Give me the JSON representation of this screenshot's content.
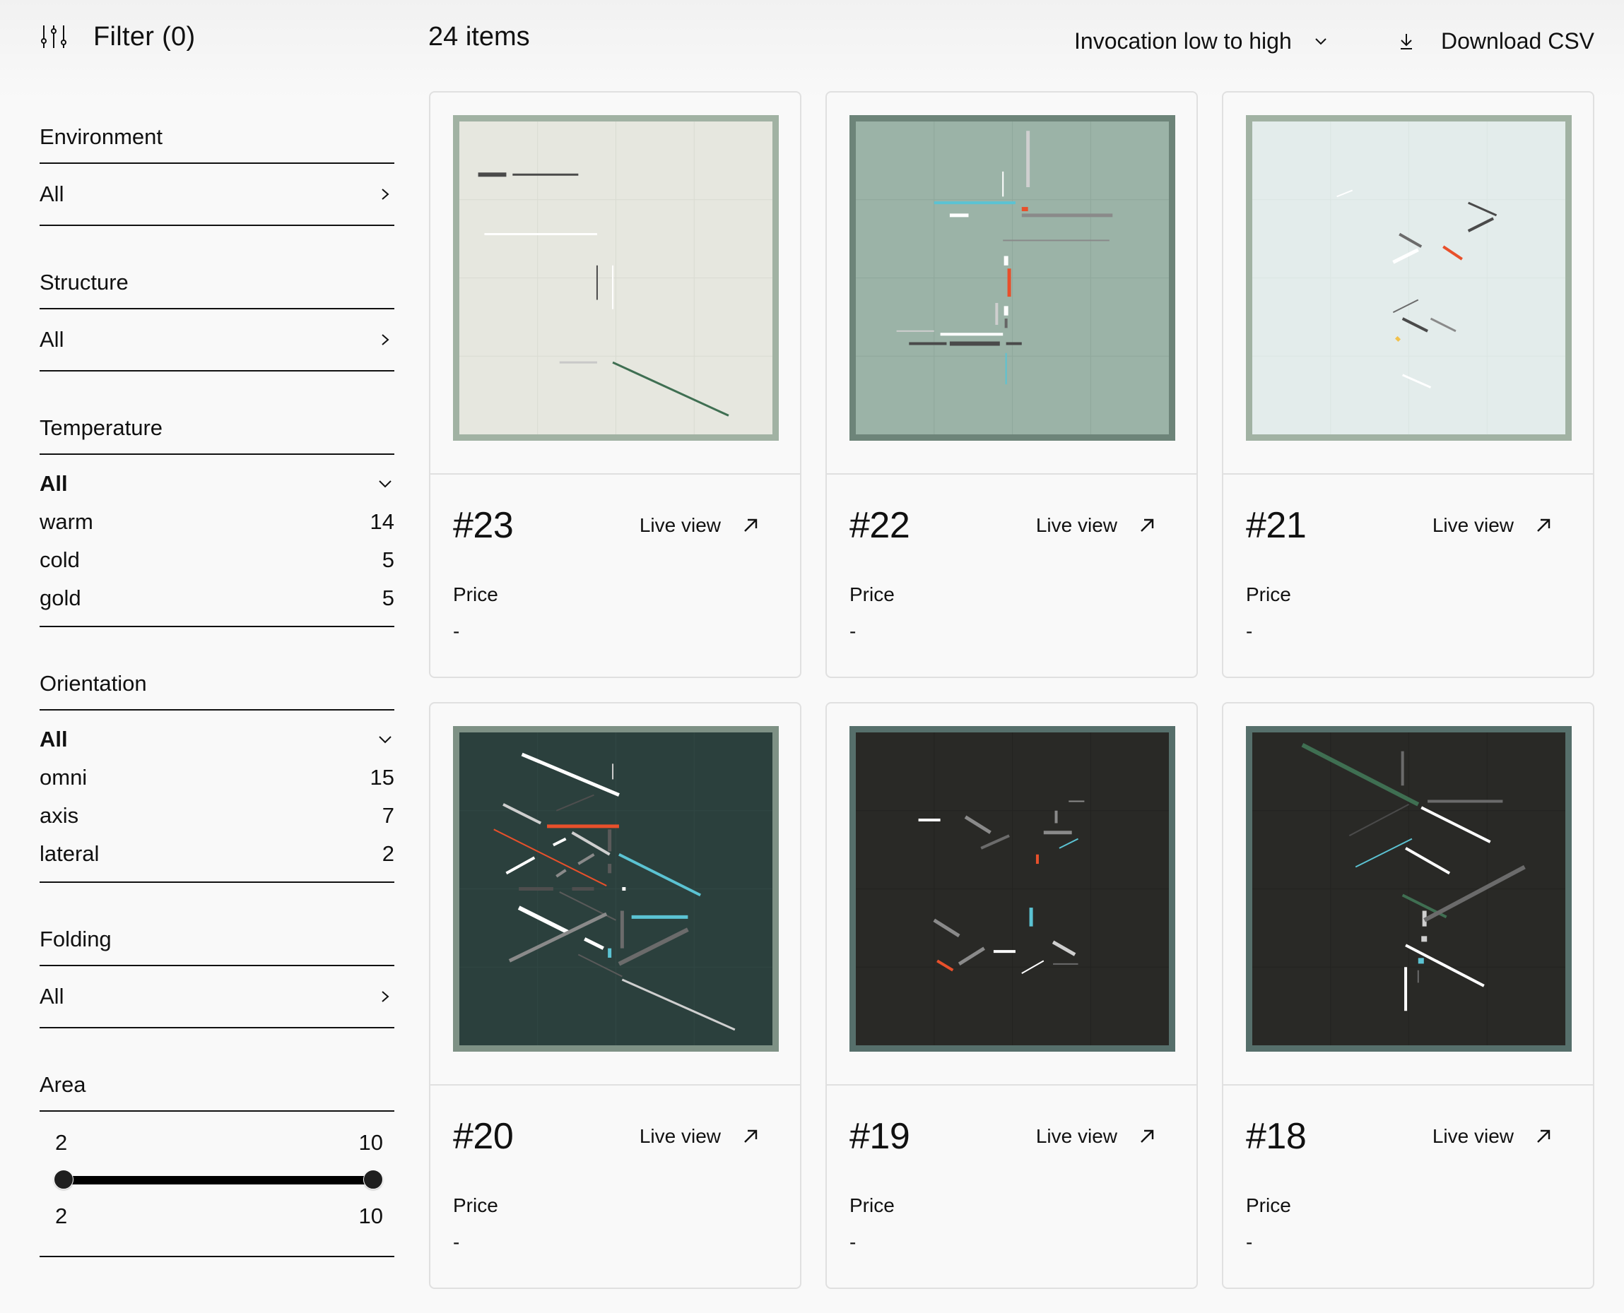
{
  "toolbar": {
    "filter_label": "Filter (0)",
    "filter_icon": "sliders-icon",
    "item_count": "24 items",
    "sort_label": "Invocation low to high",
    "sort_icon": "chevron-down-icon",
    "download_label": "Download CSV",
    "download_icon": "download-icon"
  },
  "filters": {
    "environment": {
      "title": "Environment",
      "value": "All",
      "icon": "chevron-right-icon"
    },
    "structure": {
      "title": "Structure",
      "value": "All",
      "icon": "chevron-right-icon"
    },
    "temperature": {
      "title": "Temperature",
      "selected": "All",
      "icon": "chevron-down-icon",
      "options": [
        {
          "label": "warm",
          "count": "14"
        },
        {
          "label": "cold",
          "count": "5"
        },
        {
          "label": "gold",
          "count": "5"
        }
      ]
    },
    "orientation": {
      "title": "Orientation",
      "selected": "All",
      "icon": "chevron-down-icon",
      "options": [
        {
          "label": "omni",
          "count": "15"
        },
        {
          "label": "axis",
          "count": "7"
        },
        {
          "label": "lateral",
          "count": "2"
        }
      ]
    },
    "folding": {
      "title": "Folding",
      "value": "All",
      "icon": "chevron-right-icon"
    },
    "area": {
      "title": "Area",
      "min_label": "2",
      "max_label": "10",
      "selected_min": "2",
      "selected_max": "10",
      "range": [
        2,
        10
      ],
      "selected": [
        2,
        10
      ]
    }
  },
  "colors": {
    "accent_red": "#e8502b",
    "accent_cyan": "#5bc3d3",
    "accent_green": "#3f6f52",
    "accent_yellow": "#f2c14b"
  },
  "cards": [
    {
      "number": "#23",
      "live_label": "Live view",
      "price_label": "Price",
      "price_value": "-",
      "art": {
        "frame": "#a1b2a3",
        "bg": "#e6e7df",
        "grid": "#d9dbd2",
        "lines": [
          [
            0.17,
            0.17,
            0.38,
            0.17,
            "#4a4a4a",
            3
          ],
          [
            0.08,
            0.36,
            0.44,
            0.36,
            "#ffffff",
            3
          ],
          [
            0.44,
            0.46,
            0.44,
            0.57,
            "#4a4a4a",
            2
          ],
          [
            0.49,
            0.46,
            0.49,
            0.6,
            "#ffffff",
            2
          ],
          [
            0.32,
            0.77,
            0.44,
            0.77,
            "#c8c8c8",
            3
          ],
          [
            0.49,
            0.77,
            0.86,
            0.94,
            "#3f6f52",
            3
          ],
          [
            0.06,
            0.17,
            0.15,
            0.17,
            "#4a4a4a",
            6
          ]
        ]
      }
    },
    {
      "number": "#22",
      "live_label": "Live view",
      "price_label": "Price",
      "price_value": "-",
      "art": {
        "frame": "#6d8479",
        "bg": "#9bb3a7",
        "grid": "#8fa89c",
        "lines": [
          [
            0.55,
            0.03,
            0.55,
            0.21,
            "#cfcfcf",
            5
          ],
          [
            0.47,
            0.16,
            0.47,
            0.24,
            "#ffffff",
            2
          ],
          [
            0.25,
            0.26,
            0.51,
            0.26,
            "#5bc3d3",
            4
          ],
          [
            0.53,
            0.28,
            0.55,
            0.28,
            "#e8502b",
            6
          ],
          [
            0.3,
            0.3,
            0.36,
            0.3,
            "#ffffff",
            5
          ],
          [
            0.53,
            0.3,
            0.82,
            0.3,
            "#8a8a8a",
            5
          ],
          [
            0.47,
            0.38,
            0.81,
            0.38,
            "#8a8a8a",
            2
          ],
          [
            0.48,
            0.43,
            0.48,
            0.46,
            "#ffffff",
            6
          ],
          [
            0.49,
            0.47,
            0.49,
            0.56,
            "#e8502b",
            5
          ],
          [
            0.45,
            0.58,
            0.45,
            0.65,
            "#cfcfcf",
            4
          ],
          [
            0.48,
            0.59,
            0.48,
            0.62,
            "#ffffff",
            6
          ],
          [
            0.48,
            0.63,
            0.48,
            0.66,
            "#666666",
            4
          ],
          [
            0.13,
            0.67,
            0.25,
            0.67,
            "#cfcfcf",
            2
          ],
          [
            0.27,
            0.68,
            0.47,
            0.68,
            "#ffffff",
            4
          ],
          [
            0.17,
            0.71,
            0.29,
            0.71,
            "#4a4a4a",
            4
          ],
          [
            0.3,
            0.71,
            0.46,
            0.71,
            "#4a4a4a",
            6
          ],
          [
            0.48,
            0.71,
            0.53,
            0.71,
            "#4a4a4a",
            4
          ],
          [
            0.48,
            0.74,
            0.48,
            0.84,
            "#5bc3d3",
            2
          ]
        ]
      }
    },
    {
      "number": "#21",
      "live_label": "Live view",
      "price_label": "Price",
      "price_value": "-",
      "art": {
        "frame": "#a1b2a3",
        "bg": "#e3eceb",
        "grid": "#dbe5e3",
        "lines": [
          [
            0.27,
            0.24,
            0.32,
            0.22,
            "#ffffff",
            2
          ],
          [
            0.69,
            0.26,
            0.78,
            0.3,
            "#4a4a4a",
            3
          ],
          [
            0.69,
            0.35,
            0.77,
            0.31,
            "#4a4a4a",
            4
          ],
          [
            0.47,
            0.36,
            0.54,
            0.4,
            "#6b6b6b",
            4
          ],
          [
            0.61,
            0.4,
            0.67,
            0.44,
            "#e8502b",
            4
          ],
          [
            0.45,
            0.45,
            0.53,
            0.41,
            "#ffffff",
            5
          ],
          [
            0.45,
            0.61,
            0.53,
            0.57,
            "#6b6b6b",
            2
          ],
          [
            0.48,
            0.63,
            0.56,
            0.67,
            "#4a4a4a",
            4
          ],
          [
            0.57,
            0.63,
            0.65,
            0.67,
            "#8a8a8a",
            3
          ],
          [
            0.46,
            0.69,
            0.47,
            0.7,
            "#f2c14b",
            5
          ],
          [
            0.48,
            0.81,
            0.57,
            0.85,
            "#ffffff",
            3
          ]
        ]
      }
    },
    {
      "number": "#20",
      "live_label": "Live view",
      "price_label": "Price",
      "price_value": "-",
      "art": {
        "frame": "#7e9185",
        "bg": "#2b403d",
        "grid": "#314744",
        "lines": [
          [
            0.2,
            0.07,
            0.51,
            0.2,
            "#ffffff",
            5
          ],
          [
            0.49,
            0.1,
            0.49,
            0.15,
            "#cfcfcf",
            2
          ],
          [
            0.31,
            0.25,
            0.43,
            0.2,
            "#4e4e4e",
            2
          ],
          [
            0.14,
            0.23,
            0.26,
            0.29,
            "#cfcfcf",
            4
          ],
          [
            0.28,
            0.3,
            0.51,
            0.3,
            "#e8502b",
            5
          ],
          [
            0.11,
            0.31,
            0.47,
            0.49,
            "#e8502b",
            2
          ],
          [
            0.48,
            0.31,
            0.48,
            0.38,
            "#5a5a5a",
            5
          ],
          [
            0.36,
            0.32,
            0.48,
            0.39,
            "#cfcfcf",
            4
          ],
          [
            0.3,
            0.36,
            0.34,
            0.34,
            "#ffffff",
            4
          ],
          [
            0.51,
            0.39,
            0.77,
            0.52,
            "#5bc3d3",
            4
          ],
          [
            0.15,
            0.45,
            0.24,
            0.4,
            "#ffffff",
            4
          ],
          [
            0.38,
            0.42,
            0.43,
            0.39,
            "#8a8a8a",
            4
          ],
          [
            0.48,
            0.42,
            0.48,
            0.45,
            "#5a5a5a",
            5
          ],
          [
            0.31,
            0.46,
            0.34,
            0.44,
            "#8a8a8a",
            4
          ],
          [
            0.19,
            0.5,
            0.3,
            0.5,
            "#4e4e4e",
            5
          ],
          [
            0.36,
            0.5,
            0.43,
            0.5,
            "#4e4e4e",
            5
          ],
          [
            0.52,
            0.5,
            0.52,
            0.5,
            "#ffffff",
            5
          ],
          [
            0.32,
            0.51,
            0.5,
            0.6,
            "#5a5a5a",
            2
          ],
          [
            0.19,
            0.56,
            0.35,
            0.64,
            "#ffffff",
            6
          ],
          [
            0.16,
            0.73,
            0.47,
            0.58,
            "#8a8a8a",
            5
          ],
          [
            0.52,
            0.57,
            0.52,
            0.69,
            "#6b6b6b",
            5
          ],
          [
            0.55,
            0.59,
            0.73,
            0.59,
            "#5bc3d3",
            5
          ],
          [
            0.4,
            0.66,
            0.46,
            0.69,
            "#ffffff",
            5
          ],
          [
            0.48,
            0.69,
            0.48,
            0.72,
            "#5bc3d3",
            5
          ],
          [
            0.51,
            0.74,
            0.73,
            0.63,
            "#6b6b6b",
            6
          ],
          [
            0.38,
            0.71,
            0.52,
            0.78,
            "#5a5a5a",
            2
          ],
          [
            0.52,
            0.79,
            0.88,
            0.95,
            "#cfcfcf",
            3
          ]
        ]
      }
    },
    {
      "number": "#19",
      "live_label": "Live view",
      "price_label": "Price",
      "price_value": "-",
      "art": {
        "frame": "#566f6b",
        "bg": "#292926",
        "grid": "#232320",
        "lines": [
          [
            0.2,
            0.28,
            0.27,
            0.28,
            "#ffffff",
            4
          ],
          [
            0.35,
            0.27,
            0.43,
            0.32,
            "#8a8a8a",
            5
          ],
          [
            0.4,
            0.37,
            0.49,
            0.33,
            "#6b6b6b",
            4
          ],
          [
            0.64,
            0.25,
            0.64,
            0.29,
            "#8a8a8a",
            4
          ],
          [
            0.68,
            0.22,
            0.73,
            0.22,
            "#8a8a8a",
            2
          ],
          [
            0.6,
            0.32,
            0.69,
            0.32,
            "#8a8a8a",
            5
          ],
          [
            0.65,
            0.37,
            0.71,
            0.34,
            "#5bc3d3",
            2
          ],
          [
            0.58,
            0.39,
            0.58,
            0.42,
            "#e8502b",
            4
          ],
          [
            0.56,
            0.56,
            0.56,
            0.62,
            "#5bc3d3",
            5
          ],
          [
            0.25,
            0.6,
            0.33,
            0.65,
            "#8a8a8a",
            5
          ],
          [
            0.63,
            0.67,
            0.7,
            0.71,
            "#cfcfcf",
            5
          ],
          [
            0.33,
            0.74,
            0.41,
            0.69,
            "#8a8a8a",
            5
          ],
          [
            0.44,
            0.7,
            0.51,
            0.7,
            "#ffffff",
            4
          ],
          [
            0.26,
            0.73,
            0.31,
            0.76,
            "#e8502b",
            4
          ],
          [
            0.53,
            0.77,
            0.6,
            0.73,
            "#ffffff",
            2
          ],
          [
            0.63,
            0.74,
            0.71,
            0.74,
            "#6b6b6b",
            2
          ]
        ]
      }
    },
    {
      "number": "#18",
      "live_label": "Live view",
      "price_label": "Price",
      "price_value": "-",
      "art": {
        "frame": "#566f6b",
        "bg": "#292926",
        "grid": "#232320",
        "lines": [
          [
            0.16,
            0.04,
            0.53,
            0.23,
            "#3f6f52",
            6
          ],
          [
            0.48,
            0.06,
            0.48,
            0.17,
            "#6b6b6b",
            4
          ],
          [
            0.56,
            0.22,
            0.8,
            0.22,
            "#6b6b6b",
            4
          ],
          [
            0.54,
            0.24,
            0.76,
            0.35,
            "#ffffff",
            4
          ],
          [
            0.31,
            0.33,
            0.5,
            0.23,
            "#4a4a4a",
            2
          ],
          [
            0.33,
            0.43,
            0.51,
            0.34,
            "#5bc3d3",
            2
          ],
          [
            0.49,
            0.37,
            0.63,
            0.45,
            "#ffffff",
            4
          ],
          [
            0.48,
            0.52,
            0.62,
            0.59,
            "#3f6f52",
            4
          ],
          [
            0.55,
            0.57,
            0.55,
            0.62,
            "#cfcfcf",
            6
          ],
          [
            0.55,
            0.6,
            0.87,
            0.43,
            "#6b6b6b",
            6
          ],
          [
            0.54,
            0.66,
            0.54,
            0.66,
            "#cfcfcf",
            8
          ],
          [
            0.49,
            0.68,
            0.74,
            0.81,
            "#ffffff",
            4
          ],
          [
            0.53,
            0.73,
            0.53,
            0.73,
            "#5bc3d3",
            8
          ],
          [
            0.49,
            0.75,
            0.49,
            0.89,
            "#ffffff",
            4
          ],
          [
            0.53,
            0.76,
            0.53,
            0.8,
            "#6b6b6b",
            2
          ]
        ]
      }
    }
  ]
}
